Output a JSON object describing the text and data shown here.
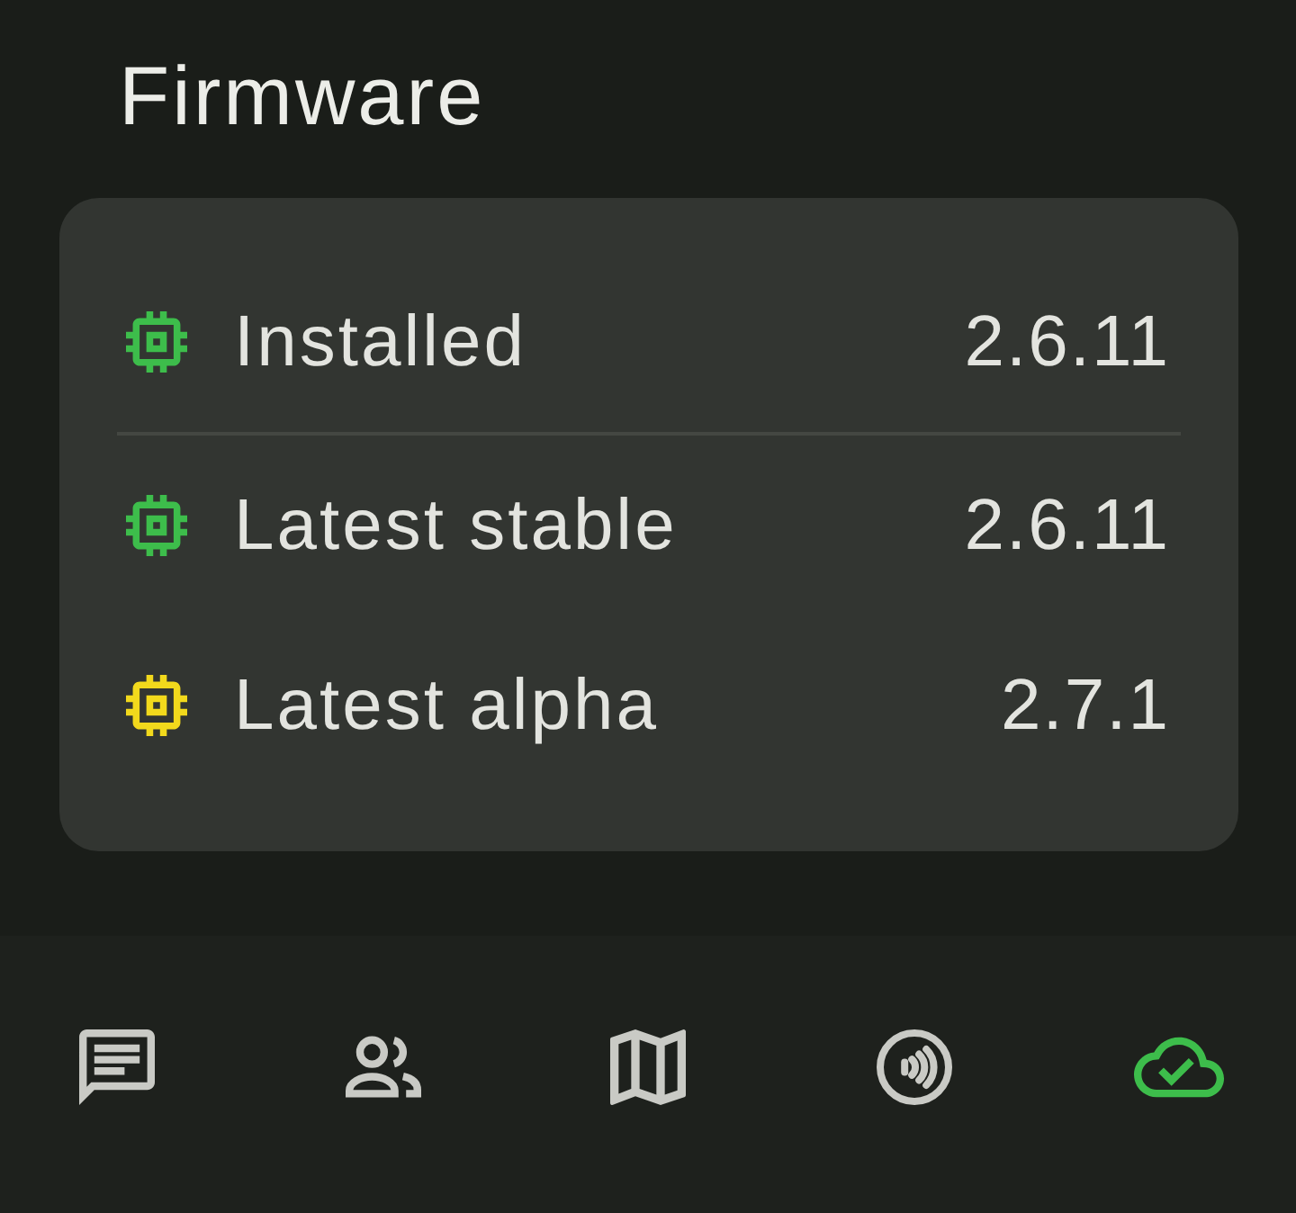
{
  "title": "Firmware",
  "groups": [
    {
      "rows": [
        {
          "label": "Installed",
          "value": "2.6.11",
          "color": "#3dbd4b"
        }
      ]
    },
    {
      "rows": [
        {
          "label": "Latest stable",
          "value": "2.6.11",
          "color": "#3dbd4b"
        },
        {
          "label": "Latest alpha",
          "value": "2.7.1",
          "color": "#f2d91c"
        }
      ]
    }
  ],
  "nav": [
    {
      "kind": "chat",
      "selected": false
    },
    {
      "kind": "people",
      "selected": false
    },
    {
      "kind": "map",
      "selected": false
    },
    {
      "kind": "signal",
      "selected": false
    },
    {
      "kind": "cloud",
      "selected": true
    }
  ]
}
